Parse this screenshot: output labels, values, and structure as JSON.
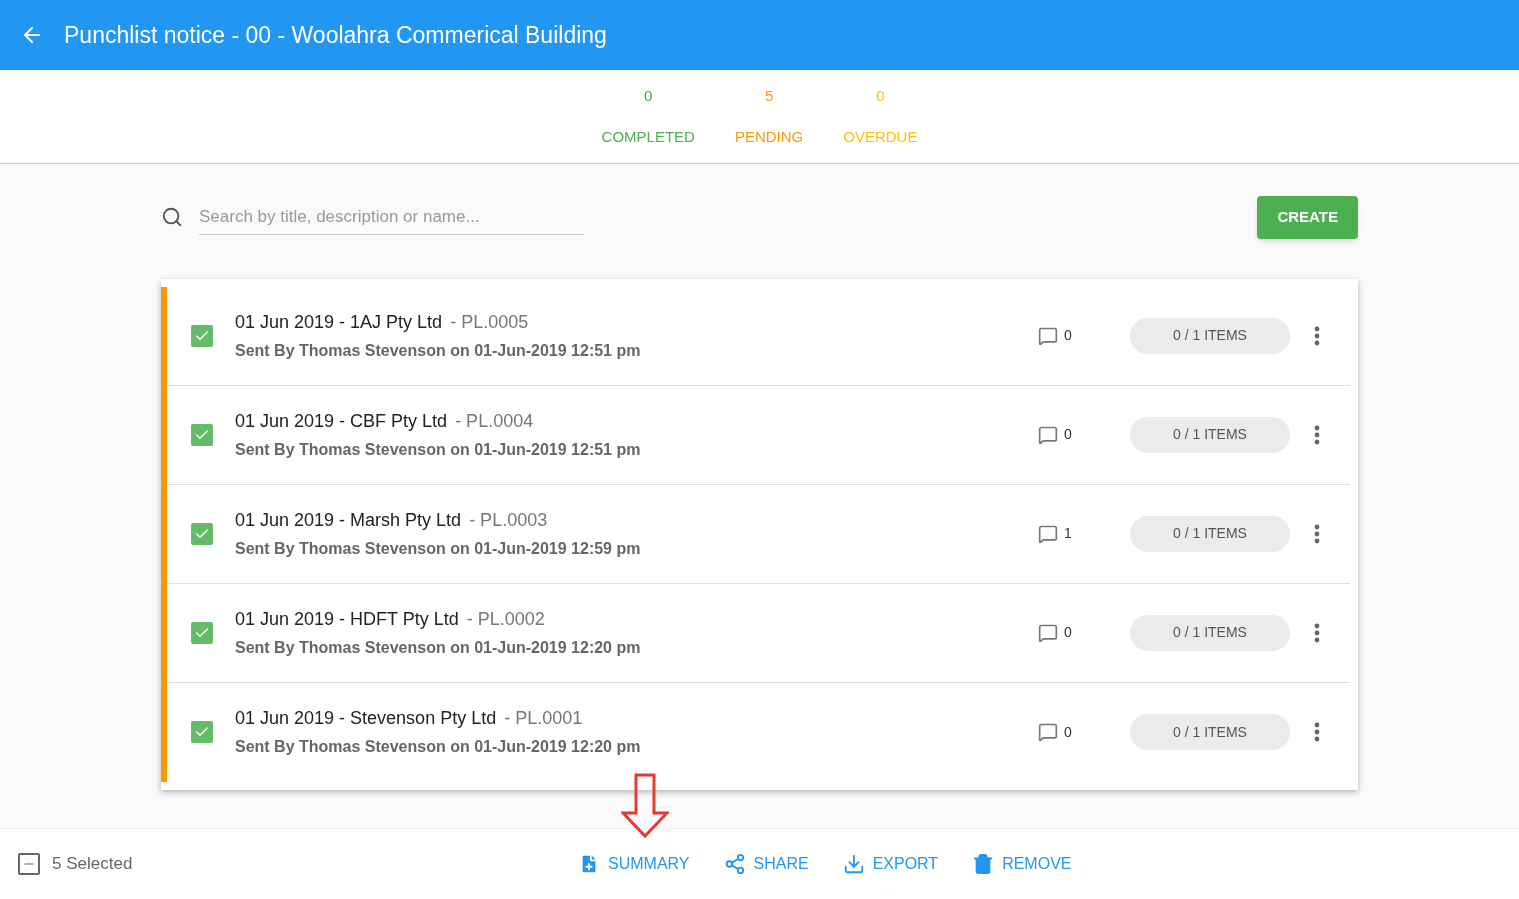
{
  "header": {
    "title": "Punchlist notice - 00 - Woolahra Commerical Building"
  },
  "stats": [
    {
      "count": "0",
      "label": "COMPLETED",
      "color": "#4caf50"
    },
    {
      "count": "5",
      "label": "PENDING",
      "color": "#ff9800"
    },
    {
      "count": "0",
      "label": "OVERDUE",
      "color": "#ffc107"
    }
  ],
  "search": {
    "placeholder": "Search by title, description or name..."
  },
  "create_button": "CREATE",
  "notices": [
    {
      "title": "01 Jun 2019 - 1AJ Pty Ltd",
      "code": "- PL.0005",
      "sent": "Sent By Thomas Stevenson on 01-Jun-2019 12:51 pm",
      "comments": "0",
      "items": "0 / 1 ITEMS",
      "checked": true
    },
    {
      "title": "01 Jun 2019 - CBF Pty Ltd",
      "code": "- PL.0004",
      "sent": "Sent By Thomas Stevenson on 01-Jun-2019 12:51 pm",
      "comments": "0",
      "items": "0 / 1 ITEMS",
      "checked": true
    },
    {
      "title": "01 Jun 2019 - Marsh Pty Ltd",
      "code": "- PL.0003",
      "sent": "Sent By Thomas Stevenson on 01-Jun-2019 12:59 pm",
      "comments": "1",
      "items": "0 / 1 ITEMS",
      "checked": true
    },
    {
      "title": "01 Jun 2019 - HDFT Pty Ltd",
      "code": "- PL.0002",
      "sent": "Sent By Thomas Stevenson on 01-Jun-2019 12:20 pm",
      "comments": "0",
      "items": "0 / 1 ITEMS",
      "checked": true
    },
    {
      "title": "01 Jun 2019 - Stevenson Pty Ltd",
      "code": "- PL.0001",
      "sent": "Sent By Thomas Stevenson on 01-Jun-2019 12:20 pm",
      "comments": "0",
      "items": "0 / 1 ITEMS",
      "checked": true
    }
  ],
  "footer": {
    "select_all_indeterminate": true,
    "selected": "5 Selected",
    "actions": [
      {
        "kind": "summary",
        "label": "SUMMARY"
      },
      {
        "kind": "share",
        "label": "SHARE"
      },
      {
        "kind": "export",
        "label": "EXPORT"
      },
      {
        "kind": "remove",
        "label": "REMOVE"
      }
    ]
  }
}
